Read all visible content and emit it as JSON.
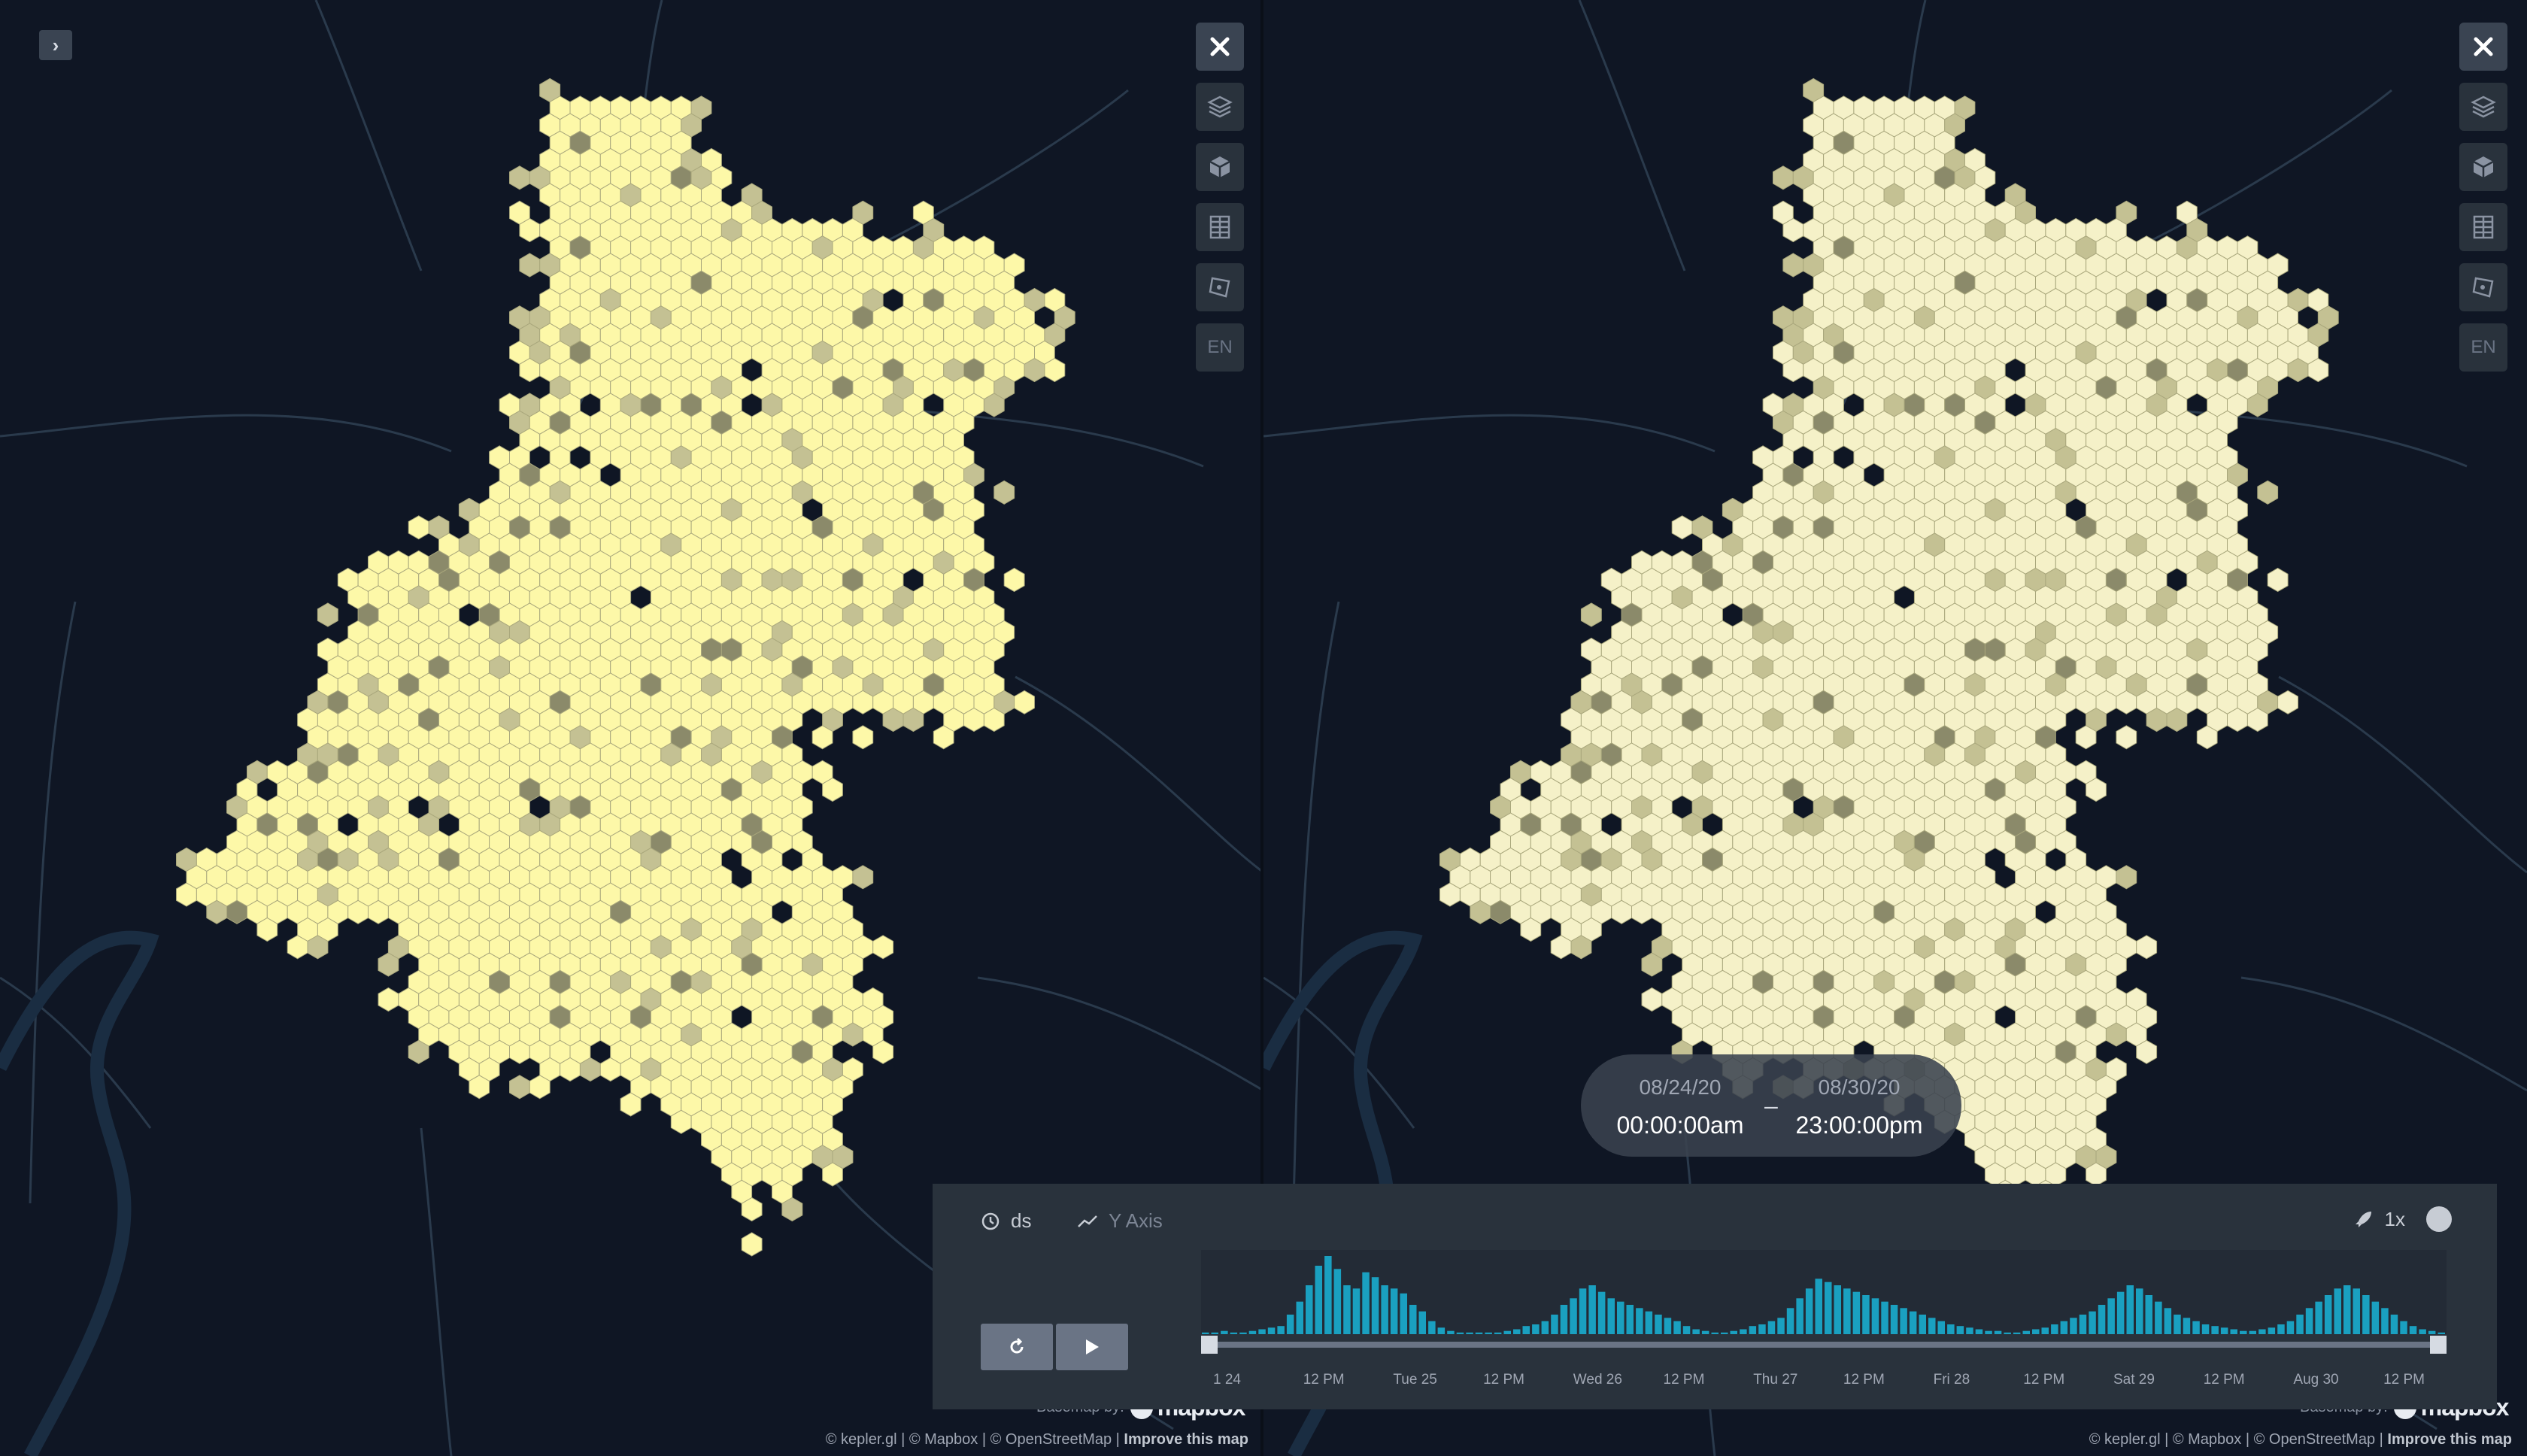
{
  "left_pane": {
    "expand_icon": "chevron-right-icon",
    "attribution": {
      "credits": "© kepler.gl | © Mapbox | © OpenStreetMap | ",
      "improve_link": "Improve this map"
    },
    "basemap": {
      "label": "Basemap by:",
      "brand": "mapbox"
    }
  },
  "right_pane": {
    "attribution": {
      "credits": "© kepler.gl | © Mapbox | © OpenStreetMap | ",
      "improve_link": "Improve this map"
    },
    "basemap": {
      "label": "Basemap by:",
      "brand": "mapbox"
    }
  },
  "map_controls": {
    "close_icon": "close-icon",
    "layers_icon": "layers-icon",
    "view_3d_icon": "cube-3d-icon",
    "data_table_icon": "table-icon",
    "draw_polygon_icon": "draw-polygon-icon",
    "locale_label": "EN"
  },
  "colors": {
    "background": "#0f1624",
    "road": "#2a3a4c",
    "water": "#1a2d42",
    "hex_left_main": "#fdf8a8",
    "hex_right_main": "#f5f1c8",
    "hex_mid": "#c4c193",
    "hex_dark": "#8b8a6a",
    "histogram_bar": "#1aa0c0"
  },
  "time_display": {
    "start_date": "08/24/20",
    "start_time": "00:00:00am",
    "separator": "–",
    "end_date": "08/30/20",
    "end_time": "23:00:00pm"
  },
  "timeline": {
    "field_label": "ds",
    "field_icon": "clock-icon",
    "y_axis_label": "Y Axis",
    "y_axis_icon": "line-chart-icon",
    "speed_icon": "rocket-icon",
    "speed_label": "1x",
    "settings_icon": "globe-icon",
    "reset_icon": "reset-icon",
    "play_icon": "play-icon",
    "ticks": [
      "1 24",
      "12 PM",
      "Tue 25",
      "12 PM",
      "Wed 26",
      "12 PM",
      "Thu 27",
      "12 PM",
      "Fri 28",
      "12 PM",
      "Sat 29",
      "12 PM",
      "Aug 30",
      "12 PM"
    ]
  },
  "chart_data": {
    "type": "bar",
    "x_range": [
      "08/24/20 00:00",
      "08/30/20 23:00"
    ],
    "values": [
      1,
      1,
      2,
      1,
      1,
      2,
      3,
      4,
      5,
      12,
      20,
      30,
      42,
      48,
      40,
      30,
      28,
      38,
      35,
      30,
      28,
      25,
      18,
      14,
      8,
      4,
      2,
      1,
      1,
      1,
      1,
      1,
      2,
      3,
      5,
      6,
      8,
      12,
      18,
      22,
      28,
      30,
      26,
      22,
      20,
      18,
      16,
      14,
      12,
      10,
      8,
      5,
      3,
      2,
      1,
      1,
      2,
      3,
      5,
      6,
      8,
      10,
      16,
      22,
      28,
      34,
      32,
      30,
      28,
      26,
      24,
      22,
      20,
      18,
      16,
      14,
      12,
      10,
      8,
      6,
      5,
      4,
      3,
      2,
      2,
      1,
      1,
      2,
      3,
      4,
      6,
      8,
      10,
      12,
      14,
      18,
      22,
      26,
      30,
      28,
      24,
      20,
      16,
      12,
      10,
      8,
      6,
      5,
      4,
      3,
      2,
      2,
      3,
      4,
      6,
      8,
      12,
      16,
      20,
      24,
      28,
      30,
      28,
      24,
      20,
      16,
      12,
      8,
      5,
      3,
      2,
      1
    ]
  }
}
